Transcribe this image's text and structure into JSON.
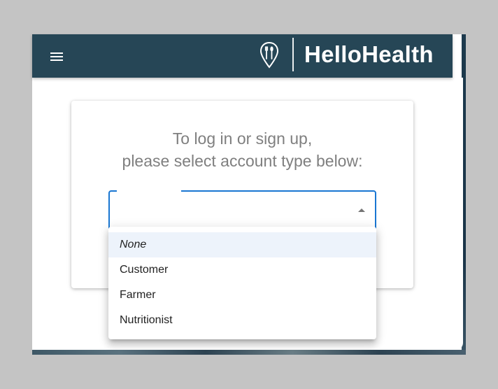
{
  "header": {
    "brand": "HelloHealth",
    "menu_icon": "hamburger-menu-icon",
    "logo_icon": "fork-spoon-pin-icon"
  },
  "card": {
    "prompt_line1": "To log in or sign up,",
    "prompt_line2": "please select account type below:"
  },
  "account_select": {
    "value": "",
    "options": [
      {
        "label": "None",
        "selected": true
      },
      {
        "label": "Customer",
        "selected": false
      },
      {
        "label": "Farmer",
        "selected": false
      },
      {
        "label": "Nutritionist",
        "selected": false
      }
    ]
  },
  "colors": {
    "appbar": "#264656",
    "focus": "#1976d2",
    "prompt_text": "#7f7f7f",
    "selected_option_bg": "#edf3fb"
  }
}
